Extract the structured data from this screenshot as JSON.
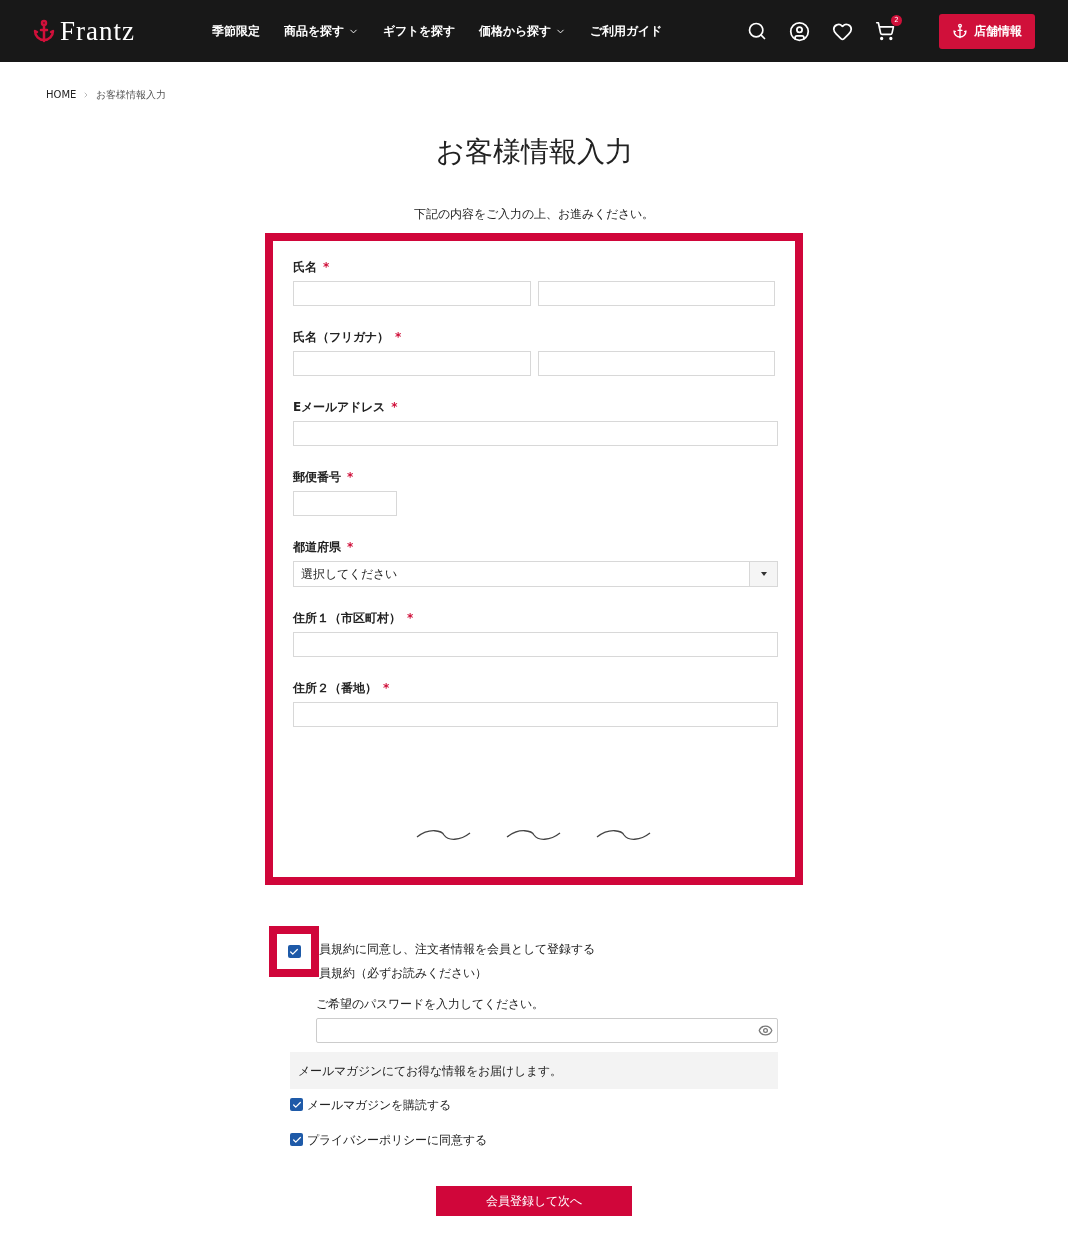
{
  "header": {
    "logo": "Frantz",
    "nav": [
      {
        "label": "季節限定",
        "dropdown": false
      },
      {
        "label": "商品を探す",
        "dropdown": true
      },
      {
        "label": "ギフトを探す",
        "dropdown": false
      },
      {
        "label": "価格から探す",
        "dropdown": true
      },
      {
        "label": "ご利用ガイド",
        "dropdown": false
      }
    ],
    "cart_count": "2",
    "store_button": "店舗情報"
  },
  "breadcrumb": [
    "HOME",
    "お客様情報入力"
  ],
  "title": "お客様情報入力",
  "intro": "下記の内容をご入力の上、お進みください。",
  "form": {
    "fields": [
      {
        "label": "氏名",
        "required": "*",
        "kind": "pair"
      },
      {
        "label": "氏名（フリガナ）",
        "required": "*",
        "kind": "pair"
      },
      {
        "label": "Eメールアドレス",
        "required": "*",
        "kind": "single"
      },
      {
        "label": "郵便番号",
        "required": "*",
        "kind": "short"
      },
      {
        "label": "都道府県",
        "required": "*",
        "kind": "select",
        "value": "選択してください"
      },
      {
        "label": "住所１（市区町村）",
        "required": "*",
        "kind": "single"
      },
      {
        "label": "住所２（番地）",
        "required": "*",
        "kind": "single"
      }
    ]
  },
  "member": {
    "checked": true,
    "line1": "員規約に同意し、注文者情報を会員として登録する",
    "line2": "員規約（必ずお読みください）",
    "password_label": "ご希望のパスワードを入力してください。"
  },
  "newsletter_note": "メールマガジンにてお得な情報をお届けします。",
  "options": [
    {
      "label": "メールマガジンを購読する",
      "checked": true
    },
    {
      "label": "プライバシーポリシーに同意する",
      "checked": true
    }
  ],
  "submit": "会員登録して次へ"
}
